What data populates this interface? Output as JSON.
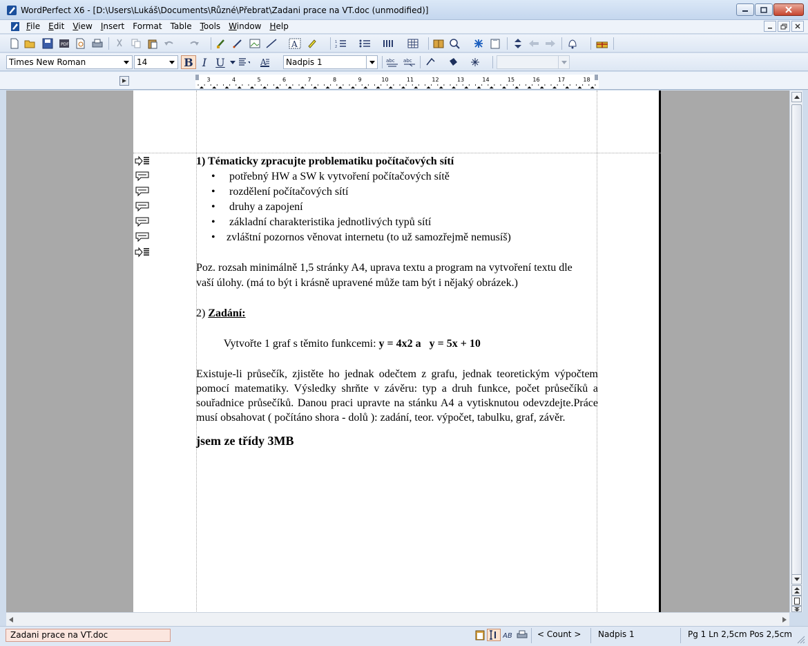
{
  "window": {
    "title": "WordPerfect X6 - [D:\\Users\\Lukáš\\Documents\\Různé\\Přebrat\\Zadani prace na VT.doc (unmodified)]"
  },
  "menu": {
    "items": [
      {
        "first": "F",
        "rest": "ile"
      },
      {
        "first": "E",
        "rest": "dit"
      },
      {
        "first": "V",
        "rest": "iew"
      },
      {
        "first": "I",
        "rest": "nsert"
      },
      {
        "first": "",
        "rest": "Format"
      },
      {
        "first": "",
        "rest": "Table"
      },
      {
        "first": "T",
        "rest": "ools"
      },
      {
        "first": "W",
        "rest": "indow"
      },
      {
        "first": "H",
        "rest": "elp"
      }
    ]
  },
  "property_bar": {
    "font_name": "Times New Roman",
    "font_size": "14",
    "bold_label": "B",
    "italic_label": "I",
    "underline_label": "U",
    "style": "Nadpis 1",
    "extra_combo": ""
  },
  "ruler": {
    "numbers": [
      "3",
      "4",
      "5",
      "6",
      "7",
      "8",
      "9",
      "10",
      "11",
      "12",
      "13",
      "14",
      "15",
      "16",
      "17",
      "18"
    ]
  },
  "document": {
    "heading1": "1)  Tématicky zpracujte problematiku počítačových sítí",
    "bullets": [
      "potřebný HW a SW k vytvoření počítačových sítě",
      "rozdělení počítačových sítí",
      "druhy a zapojení",
      " základní charakteristika  jednotlivých typů sítí",
      "zvláštní pozornos věnovat internetu (to už samozřejmě nemusíš)"
    ],
    "para1": "Poz. rozsah minimálně 1,5 stránky A4, uprava textu a program na vytvoření textu dle vaší úlohy. (má to být i krásně upravené může tam být i nějaký obrázek.)",
    "heading2_num": "2)",
    "heading2_label": "Zadání:",
    "task_intro": "  Vytvořte 1 graf s těmito funkcemi: ",
    "task_formula": "y = 4x2 a   y = 5x + 10",
    "para2": "Existuje-li průsečík, zjistěte ho jednak odečtem z grafu, jednak teoretickým výpočtem pomocí matematiky. Výsledky shrňte v závěru: typ a druh funkce, počet průsečíků a souřadnice průsečíků. Danou praci upravte na stánku A4 a vytisknutou odevzdejte.Práce musí obsahovat ( počítáno shora - dolů ): zadání, teor. výpočet, tabulku, graf, závěr.",
    "class_line": "jsem ze třídy 3MB"
  },
  "status": {
    "document_name": "Zadani prace na VT.doc",
    "count": "< Count >",
    "style": "Nadpis 1",
    "position": "Pg 1 Ln 2,5cm Pos 2,5cm"
  },
  "colors": {
    "accent": "#1c2f5c",
    "titlebar": "#cfdcee",
    "workspace": "#a9a9a9",
    "spellcheck": "#d02222"
  }
}
